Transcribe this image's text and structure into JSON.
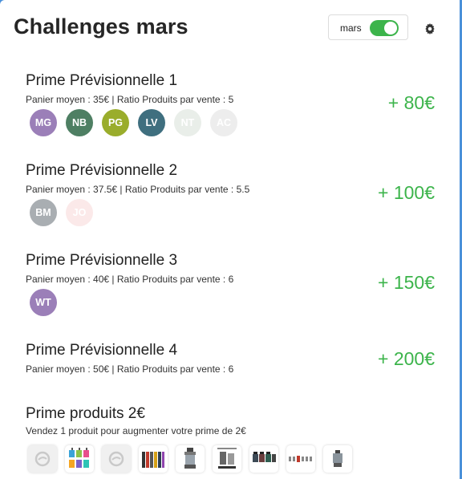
{
  "header": {
    "title": "Challenges mars",
    "month_label": "mars",
    "toggle_on": true
  },
  "challenges": [
    {
      "name": "Prime Prévisionnelle 1",
      "desc": "Panier moyen : 35€ | Ratio Produits par vente : 5",
      "amount": "+ 80€",
      "avatars": [
        {
          "initials": "MG",
          "color": "#9b7fb8",
          "faded": false
        },
        {
          "initials": "NB",
          "color": "#4e7f63",
          "faded": false
        },
        {
          "initials": "PG",
          "color": "#9aad2c",
          "faded": false
        },
        {
          "initials": "LV",
          "color": "#3f6f7f",
          "faded": false
        },
        {
          "initials": "NT",
          "color": "#e9eee9",
          "faded": true
        },
        {
          "initials": "AC",
          "color": "#ededed",
          "faded": true
        }
      ]
    },
    {
      "name": "Prime Prévisionnelle 2",
      "desc": "Panier moyen : 37.5€ | Ratio Produits par vente : 5.5",
      "amount": "+ 100€",
      "avatars": [
        {
          "initials": "BM",
          "color": "#a9aeb2",
          "faded": false
        },
        {
          "initials": "JO",
          "color": "#fbe9e9",
          "faded": true
        }
      ]
    },
    {
      "name": "Prime Prévisionnelle 3",
      "desc": "Panier moyen : 40€ | Ratio Produits par vente : 6",
      "amount": "+ 150€",
      "avatars": [
        {
          "initials": "WT",
          "color": "#9b7fb8",
          "faded": false
        }
      ]
    },
    {
      "name": "Prime Prévisionnelle 4",
      "desc": "Panier moyen : 50€ | Ratio Produits par vente : 6",
      "amount": "+ 200€",
      "avatars": []
    }
  ],
  "products_challenge": {
    "name": "Prime produits 2€",
    "desc": "Vendez 1 produit pour augmenter votre prime de 2€",
    "items": [
      {
        "kind": "placeholder-icon"
      },
      {
        "kind": "colorful-kits-image"
      },
      {
        "kind": "placeholder-icon"
      },
      {
        "kind": "batteries-image"
      },
      {
        "kind": "tank-image"
      },
      {
        "kind": "boxed-tank-image"
      },
      {
        "kind": "mini-tanks-image"
      },
      {
        "kind": "coil-pack-image"
      },
      {
        "kind": "single-tank-image"
      }
    ]
  },
  "colors": {
    "accent_green": "#3cb44b",
    "background_blue": "#4a90d9"
  }
}
